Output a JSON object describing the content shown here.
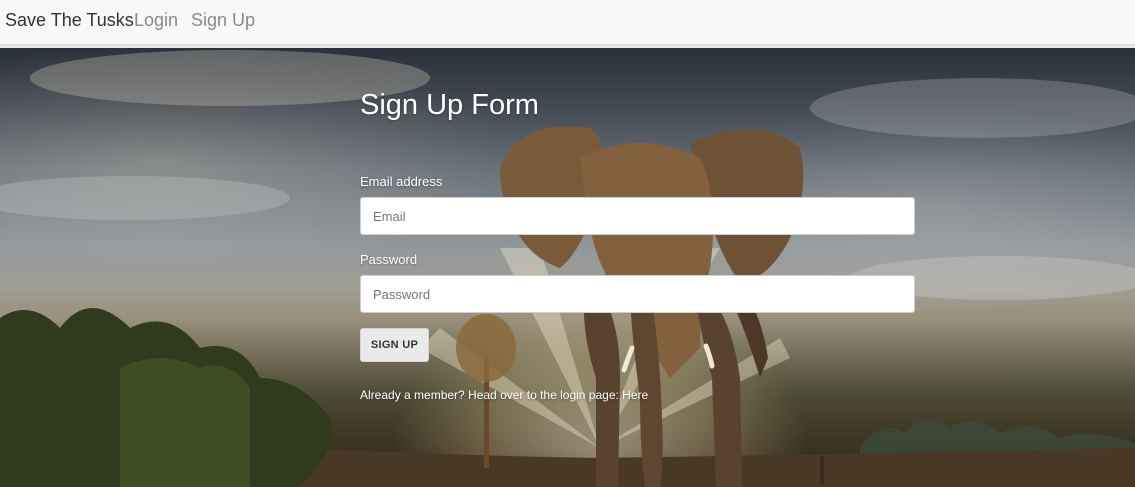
{
  "navbar": {
    "brand": "Save The Tusks",
    "links": [
      {
        "label": "Login"
      },
      {
        "label": "Sign Up"
      }
    ]
  },
  "form": {
    "title": "Sign Up Form",
    "email": {
      "label": "Email address",
      "placeholder": "Email",
      "value": ""
    },
    "password": {
      "label": "Password",
      "placeholder": "Password",
      "value": ""
    },
    "submit_label": "SIGN UP",
    "footer_text": "Already a member? Head over to the login page:",
    "footer_link": "Here"
  },
  "background": {
    "subject": "elephant walking on savanna at sunrise",
    "colors": {
      "sky": "#6f7781",
      "glow": "#f3d9a6",
      "ground": "#3a2a1c",
      "trees": "#2e3a1c"
    }
  }
}
